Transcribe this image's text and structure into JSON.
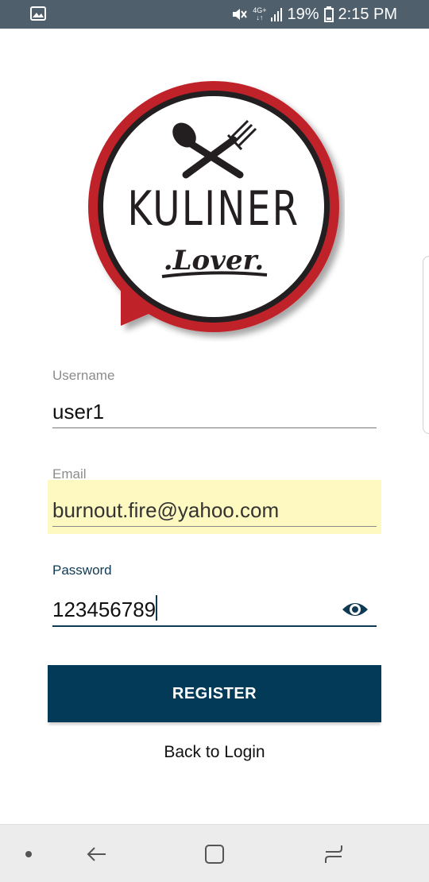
{
  "status_bar": {
    "network_type": "4G+",
    "battery": "19%",
    "time": "2:15 PM",
    "icons": [
      "image-notification-icon",
      "mute-vibrate-icon",
      "signal-icon",
      "battery-icon"
    ]
  },
  "logo": {
    "brand": "KULINER",
    "tagline": ".Lover.",
    "colors": {
      "ring": "#c0212c",
      "inner": "#231f20"
    }
  },
  "form": {
    "username": {
      "label": "Username",
      "value": "user1"
    },
    "email": {
      "label": "Email",
      "value": "burnout.fire@yahoo.com",
      "autofill_color": "#fef9c0"
    },
    "password": {
      "label": "Password",
      "value": "123456789",
      "toggle_icon": "eye-icon"
    }
  },
  "actions": {
    "register_label": "REGISTER",
    "back_label": "Back to Login"
  },
  "colors": {
    "accent": "#033a57",
    "status_bar": "#4f5f6b",
    "nav_bar": "#ececec"
  },
  "nav_bar": {
    "icons": [
      "dot-icon",
      "back-arrow-icon",
      "home-square-icon",
      "recents-icon"
    ]
  }
}
